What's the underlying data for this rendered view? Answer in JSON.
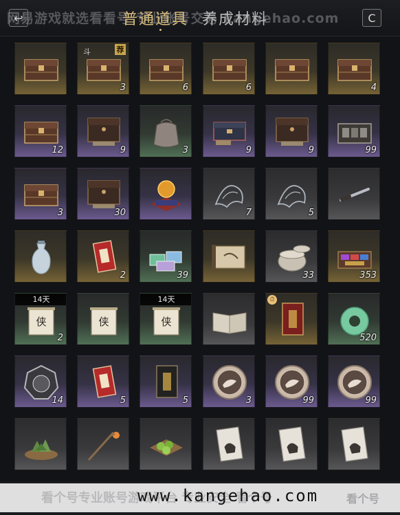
{
  "header": {
    "back_glyph": "↩",
    "tab_active": "普通道具",
    "tab_inactive": "养成材料",
    "search_glyph": "C"
  },
  "watermark": {
    "top_text": "网易游戏就选看看号  专业账号交易  kangehao.com",
    "bottom_text": "看个号专业账号游戏平台 专业安全 看个号",
    "url": "www.kangehao.com",
    "logo": "看个号"
  },
  "colors": {
    "gold": "#766336",
    "purple": "#6b5a8e",
    "green": "#506f55",
    "tab_active": "#d8bf7e"
  },
  "items": [
    {
      "icon": "wooden-chest",
      "rarity": "gold",
      "qty": ""
    },
    {
      "icon": "wooden-chest",
      "rarity": "gold",
      "qty": "3",
      "corner": "斗",
      "badge": "荐"
    },
    {
      "icon": "wooden-chest",
      "rarity": "gold",
      "qty": "6"
    },
    {
      "icon": "wooden-chest",
      "rarity": "gold",
      "qty": "6"
    },
    {
      "icon": "wooden-chest",
      "rarity": "gold",
      "qty": ""
    },
    {
      "icon": "wooden-chest",
      "rarity": "gold",
      "qty": "4"
    },
    {
      "icon": "wooden-chest",
      "rarity": "purple",
      "qty": "12"
    },
    {
      "icon": "dark-chest",
      "rarity": "purple",
      "qty": "9"
    },
    {
      "icon": "cloth-pouch",
      "rarity": "green",
      "qty": "3"
    },
    {
      "icon": "blue-chest",
      "rarity": "purple",
      "qty": "9"
    },
    {
      "icon": "dark-chest",
      "rarity": "purple",
      "qty": "9"
    },
    {
      "icon": "open-box",
      "rarity": "purple",
      "qty": "99"
    },
    {
      "icon": "wooden-chest",
      "rarity": "purple",
      "qty": "3"
    },
    {
      "icon": "dark-chest",
      "rarity": "purple",
      "qty": "30"
    },
    {
      "icon": "golden-orb",
      "rarity": "purple",
      "qty": ""
    },
    {
      "icon": "ghost-spirit",
      "rarity": "gray",
      "qty": "7"
    },
    {
      "icon": "ghost-spirit",
      "rarity": "gray",
      "qty": "5"
    },
    {
      "icon": "dagger",
      "rarity": "gray",
      "qty": ""
    },
    {
      "icon": "porcelain-vase",
      "rarity": "gold",
      "qty": ""
    },
    {
      "icon": "red-envelope",
      "rarity": "gold",
      "qty": "2"
    },
    {
      "icon": "gift-boxes",
      "rarity": "green",
      "qty": "39"
    },
    {
      "icon": "scroll-map",
      "rarity": "gold",
      "qty": ""
    },
    {
      "icon": "ceramic-jar",
      "rarity": "gray",
      "qty": "33"
    },
    {
      "icon": "gem-tray",
      "rarity": "gold",
      "qty": "353"
    },
    {
      "icon": "hero-scroll",
      "rarity": "green",
      "qty": "2",
      "timer": "14天"
    },
    {
      "icon": "hero-scroll",
      "rarity": "green",
      "qty": ""
    },
    {
      "icon": "hero-scroll",
      "rarity": "green",
      "qty": "",
      "timer": "14天"
    },
    {
      "icon": "open-book",
      "rarity": "gray",
      "qty": ""
    },
    {
      "icon": "red-tome",
      "rarity": "gold",
      "qty": "",
      "clock": "true"
    },
    {
      "icon": "jade-ring",
      "rarity": "green",
      "qty": "520"
    },
    {
      "icon": "round-token",
      "rarity": "purple",
      "qty": "14"
    },
    {
      "icon": "red-envelope",
      "rarity": "purple",
      "qty": "5"
    },
    {
      "icon": "dark-tome",
      "rarity": "purple",
      "qty": "5"
    },
    {
      "icon": "bird-coin",
      "rarity": "purple",
      "qty": "3"
    },
    {
      "icon": "bird-coin",
      "rarity": "purple",
      "qty": "99"
    },
    {
      "icon": "bird-coin",
      "rarity": "purple",
      "qty": "99"
    },
    {
      "icon": "zongzi-basket",
      "rarity": "gray",
      "qty": ""
    },
    {
      "icon": "lantern-staff",
      "rarity": "gray",
      "qty": ""
    },
    {
      "icon": "green-buns",
      "rarity": "gray",
      "qty": ""
    },
    {
      "icon": "dog-card",
      "rarity": "gray",
      "qty": ""
    },
    {
      "icon": "dog-card",
      "rarity": "gray",
      "qty": ""
    },
    {
      "icon": "dog-card",
      "rarity": "gray",
      "qty": ""
    }
  ]
}
